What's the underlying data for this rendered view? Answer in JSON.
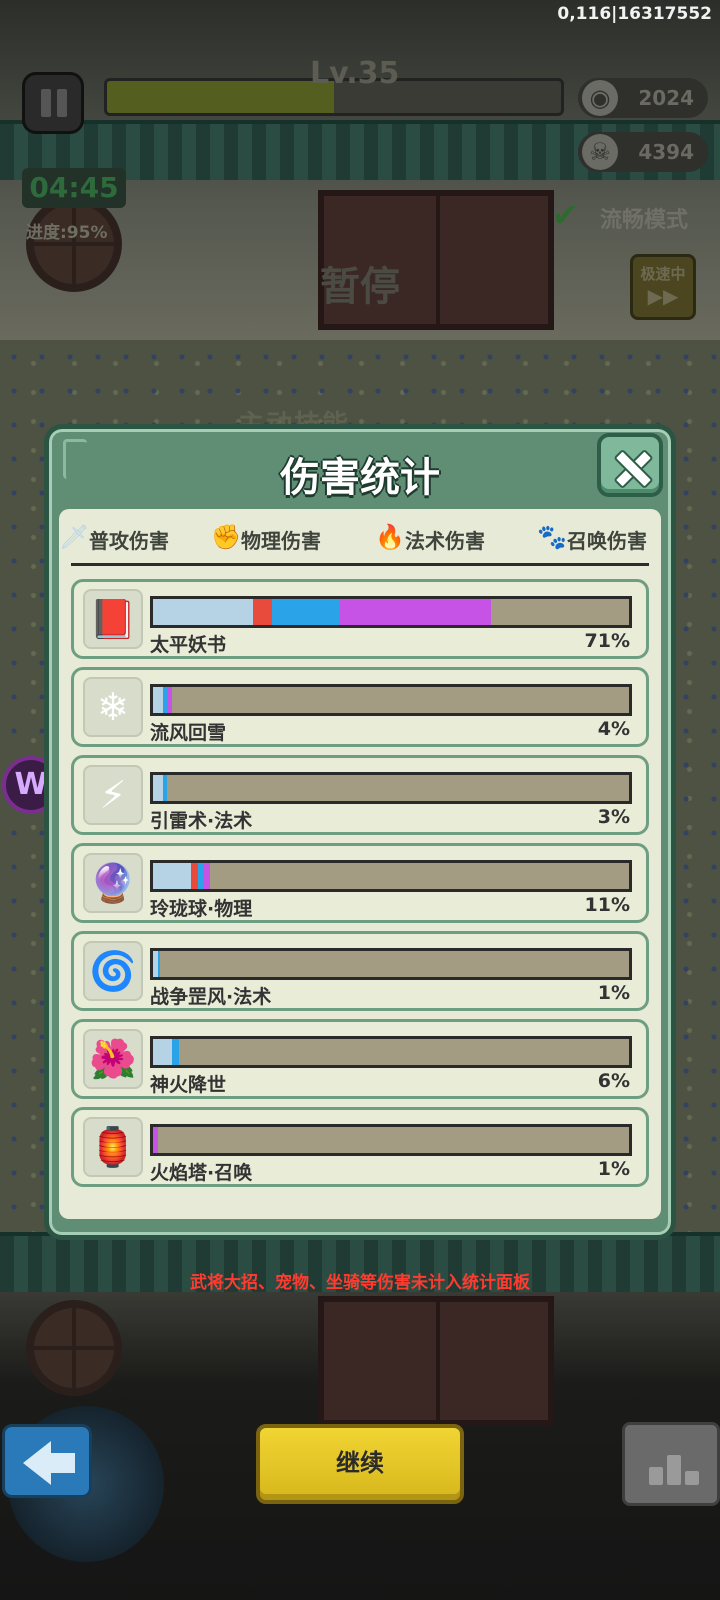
{
  "hud": {
    "top_right_readout": "0,116|16317552",
    "level": "Lv.35",
    "xp_fraction": 0.5,
    "coins": "2024",
    "skulls": "4394",
    "timer": "04:45",
    "progress": "进度:95%",
    "smooth_mode": "流畅模式",
    "paused_label": "暂停",
    "speed_label": "极速中",
    "skill_hint": "主动技能",
    "side_badge": "W"
  },
  "panel": {
    "title": "伤害统计",
    "legend": [
      {
        "label": "普攻伤害",
        "icon": "sword-icon",
        "color": "#b6d3e6"
      },
      {
        "label": "物理伤害",
        "icon": "fist-icon",
        "color": "#e84b3c"
      },
      {
        "label": "法术伤害",
        "icon": "flame-icon",
        "color": "#2ba3e8"
      },
      {
        "label": "召唤伤害",
        "icon": "paw-icon",
        "color": "#c653e6"
      }
    ]
  },
  "chart_data": {
    "type": "bar",
    "categories": [
      "太平妖书",
      "流风回雪",
      "引雷术·法术",
      "玲珑球·物理",
      "战争罡风·法术",
      "神火降世",
      "火焰塔·召唤"
    ],
    "values_pct_labels": [
      "71%",
      "4%",
      "3%",
      "11%",
      "1%",
      "6%",
      "1%"
    ],
    "series": [
      {
        "name": "普攻伤害",
        "values": [
          21,
          2,
          2,
          8,
          1,
          4,
          0
        ]
      },
      {
        "name": "物理伤害",
        "values": [
          4,
          0,
          0,
          1.5,
          0,
          0,
          0
        ]
      },
      {
        "name": "法术伤害",
        "values": [
          14,
          1,
          1,
          1,
          0.5,
          1.5,
          0
        ]
      },
      {
        "name": "召唤伤害",
        "values": [
          32,
          1,
          0,
          1.5,
          0,
          0,
          1
        ]
      }
    ],
    "stacked": true,
    "xlim": [
      0,
      100
    ],
    "icons": [
      "demon-book-icon",
      "snow-sword-icon",
      "thunder-icon",
      "orb-icon",
      "whirlwind-icon",
      "fire-flower-icon",
      "fire-tower-icon"
    ]
  },
  "footnote": "武将大招、宠物、坐骑等伤害未计入统计面板",
  "buttons": {
    "continue": "继续"
  }
}
